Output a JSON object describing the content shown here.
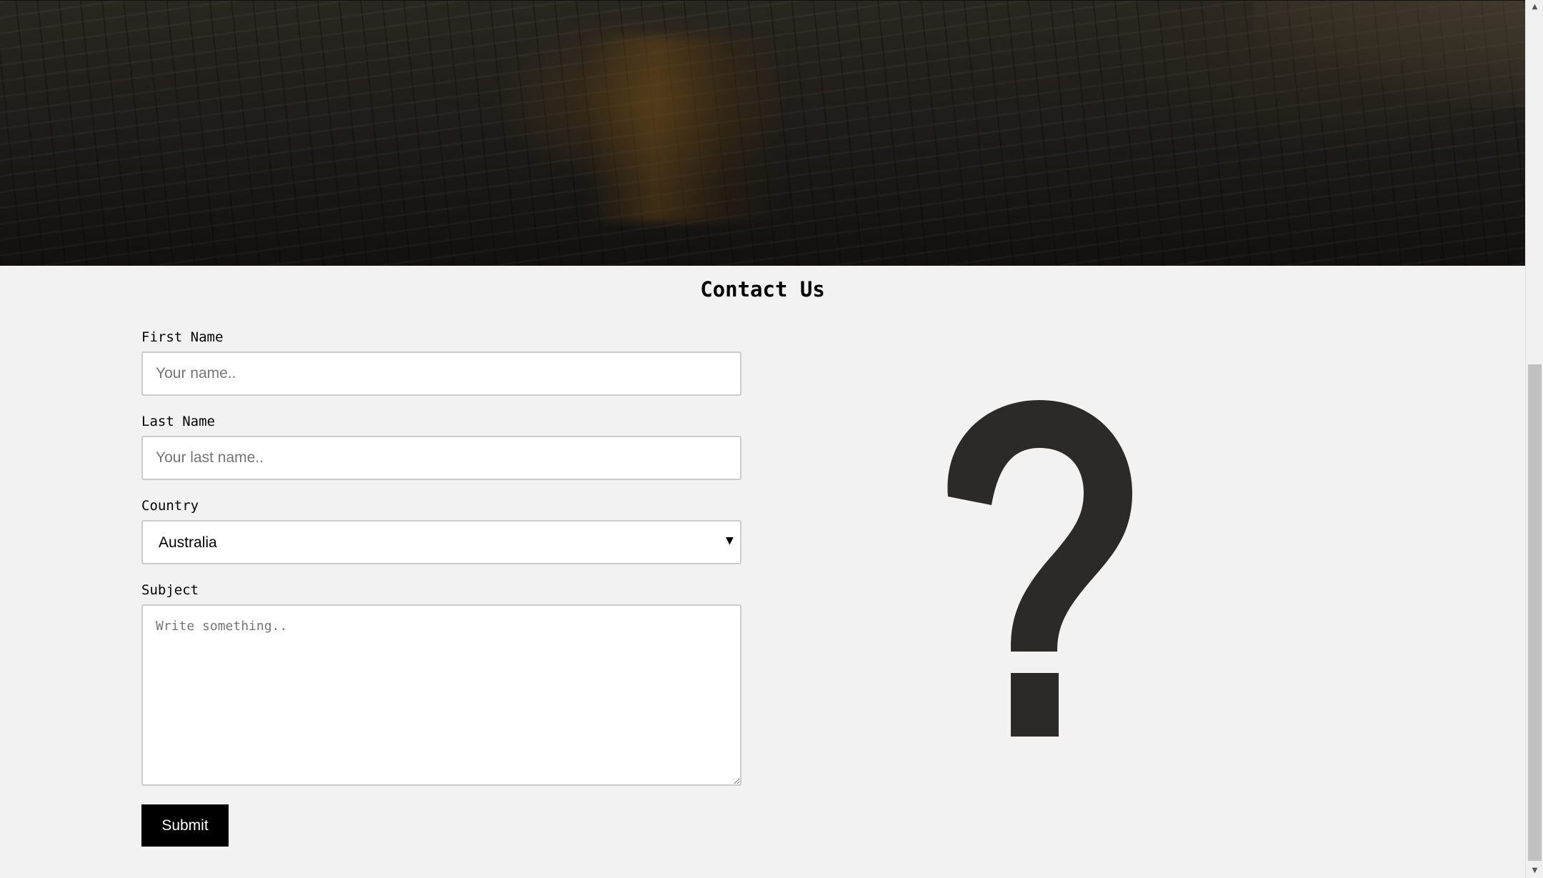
{
  "page": {
    "title": "Contact Us"
  },
  "form": {
    "first_name": {
      "label": "First Name",
      "placeholder": "Your name..",
      "value": ""
    },
    "last_name": {
      "label": "Last Name",
      "placeholder": "Your last name..",
      "value": ""
    },
    "country": {
      "label": "Country",
      "selected": "Australia"
    },
    "subject": {
      "label": "Subject",
      "placeholder": "Write something..",
      "value": ""
    },
    "submit_label": "Submit"
  },
  "icons": {
    "dropdown": "caret-down-icon",
    "illustration": "question-mark-icon",
    "scroll_up": "arrow-up-icon",
    "scroll_down": "arrow-down-icon"
  },
  "colors": {
    "background": "#f2f2f2",
    "button": "#000000",
    "button_text": "#ffffff",
    "question_mark": "#2b2a29",
    "field_border": "#cccccc"
  }
}
